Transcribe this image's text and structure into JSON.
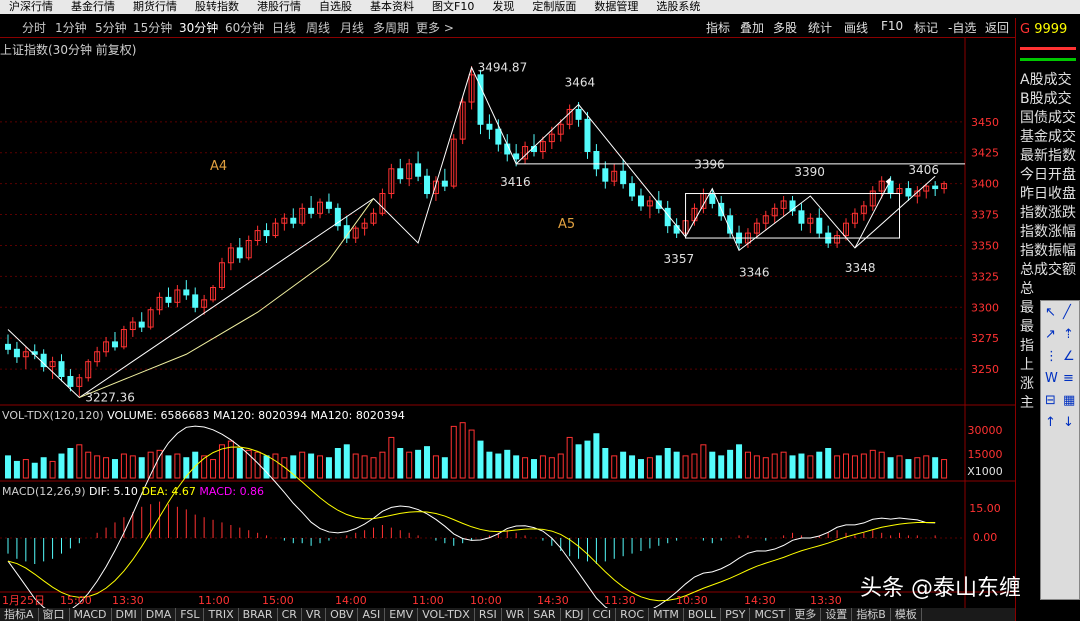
{
  "top_menu": [
    "沪深行情",
    "基金行情",
    "期货行情",
    "股转指数",
    "港股行情",
    "自选股",
    "基本资料",
    "图文F10",
    "发现",
    "定制版面",
    "数据管理",
    "选股系统"
  ],
  "period_tabs": [
    "分时",
    "1分钟",
    "5分钟",
    "15分钟",
    "30分钟",
    "60分钟",
    "日线",
    "周线",
    "月线",
    "多周期",
    "更多 >"
  ],
  "active_period": "30分钟",
  "toolbar_buttons": [
    "指标",
    "叠加",
    "多股",
    "统计",
    "画线",
    "F10",
    "标记",
    "-自选",
    "返回"
  ],
  "chart_title": "上证指数(30分钟 前复权)",
  "vol_label": {
    "name": "VOL-TDX(120,120)",
    "volume": "VOLUME: 6586683",
    "ma1": "MA120: 8020394",
    "ma2": "MA120: 8020394"
  },
  "macd_label": {
    "name": "MACD(12,26,9)",
    "dif": "DIF: 5.10",
    "dea": "DEA: 4.67",
    "macd": "MACD: 0.86"
  },
  "price_axis": [
    "3450",
    "3425",
    "3400",
    "3375",
    "3350",
    "3325",
    "3300",
    "3275",
    "3250"
  ],
  "vol_axis": [
    "30000",
    "15000",
    "X1000"
  ],
  "macd_axis": [
    "15.00",
    "0.00"
  ],
  "time_axis": [
    "1月25日",
    "15:00",
    "13:30",
    "11:00",
    "15:00",
    "14:00",
    "11:00",
    "10:00",
    "14:30",
    "11:30",
    "10:30",
    "14:30",
    "13:30"
  ],
  "annotations": {
    "high": "3494.87",
    "low": "3227.36",
    "p3464": "3464",
    "p3416": "3416",
    "p3396": "3396",
    "p3390": "3390",
    "p3406": "3406",
    "p3357": "3357",
    "p3346": "3346",
    "p3348": "3348",
    "wave_a4": "A4",
    "wave_a5": "A5"
  },
  "right_panel": {
    "header": "9999",
    "items": [
      "A股成交",
      "B股成交",
      "国债成交",
      "基金成交",
      "最新指数",
      "今日开盘",
      "昨日收盘",
      "指数涨跌",
      "指数涨幅",
      "指数振幅",
      "总成交额",
      "总",
      "最",
      "最",
      "指",
      "上",
      "涨",
      "主"
    ]
  },
  "bottom_tabs": [
    "指标A",
    "窗口",
    "MACD",
    "DMI",
    "DMA",
    "FSL",
    "TRIX",
    "BRAR",
    "CR",
    "VR",
    "OBV",
    "ASI",
    "EMV",
    "VOL-TDX",
    "RSI",
    "WR",
    "SAR",
    "KDJ",
    "CCI",
    "ROC",
    "MTM",
    "BOLL",
    "PSY",
    "MCST",
    "更多",
    "设置",
    "指标B",
    "模板"
  ],
  "watermark": "头条 @泰山东缠",
  "colors": {
    "up": "#ff3232",
    "down": "#54fcfc",
    "panel_border": "#8a0000",
    "line": "#ffffff",
    "ma_yellow": "#ffff00",
    "macd_magenta": "#ff00ff"
  },
  "chart_data": {
    "type": "candlestick",
    "ylim": [
      3225,
      3500
    ],
    "ohlc": [
      [
        3270,
        3278,
        3262,
        3266
      ],
      [
        3266,
        3272,
        3255,
        3260
      ],
      [
        3260,
        3268,
        3250,
        3264
      ],
      [
        3264,
        3270,
        3258,
        3262
      ],
      [
        3262,
        3266,
        3248,
        3252
      ],
      [
        3252,
        3260,
        3242,
        3256
      ],
      [
        3256,
        3262,
        3240,
        3244
      ],
      [
        3244,
        3250,
        3232,
        3236
      ],
      [
        3236,
        3246,
        3228,
        3243
      ],
      [
        3243,
        3258,
        3240,
        3256
      ],
      [
        3256,
        3268,
        3252,
        3264
      ],
      [
        3264,
        3276,
        3260,
        3272
      ],
      [
        3272,
        3280,
        3265,
        3268
      ],
      [
        3268,
        3285,
        3266,
        3282
      ],
      [
        3282,
        3292,
        3276,
        3288
      ],
      [
        3288,
        3296,
        3280,
        3284
      ],
      [
        3284,
        3300,
        3282,
        3298
      ],
      [
        3298,
        3312,
        3294,
        3308
      ],
      [
        3308,
        3316,
        3300,
        3304
      ],
      [
        3304,
        3318,
        3300,
        3314
      ],
      [
        3314,
        3322,
        3306,
        3310
      ],
      [
        3310,
        3316,
        3296,
        3300
      ],
      [
        3300,
        3310,
        3294,
        3306
      ],
      [
        3306,
        3318,
        3304,
        3316
      ],
      [
        3316,
        3340,
        3314,
        3336
      ],
      [
        3336,
        3352,
        3330,
        3348
      ],
      [
        3348,
        3356,
        3336,
        3340
      ],
      [
        3340,
        3358,
        3338,
        3354
      ],
      [
        3354,
        3366,
        3350,
        3362
      ],
      [
        3362,
        3368,
        3352,
        3358
      ],
      [
        3358,
        3372,
        3356,
        3368
      ],
      [
        3368,
        3376,
        3362,
        3372
      ],
      [
        3372,
        3380,
        3364,
        3368
      ],
      [
        3368,
        3384,
        3366,
        3380
      ],
      [
        3380,
        3390,
        3372,
        3376
      ],
      [
        3376,
        3388,
        3372,
        3385
      ],
      [
        3385,
        3392,
        3376,
        3380
      ],
      [
        3380,
        3384,
        3362,
        3366
      ],
      [
        3366,
        3374,
        3352,
        3356
      ],
      [
        3356,
        3366,
        3352,
        3364
      ],
      [
        3364,
        3372,
        3358,
        3368
      ],
      [
        3368,
        3380,
        3366,
        3376
      ],
      [
        3376,
        3396,
        3374,
        3392
      ],
      [
        3392,
        3416,
        3388,
        3412
      ],
      [
        3412,
        3420,
        3400,
        3404
      ],
      [
        3404,
        3420,
        3398,
        3416
      ],
      [
        3416,
        3426,
        3402,
        3406
      ],
      [
        3406,
        3412,
        3388,
        3392
      ],
      [
        3392,
        3406,
        3386,
        3402
      ],
      [
        3402,
        3412,
        3394,
        3398
      ],
      [
        3398,
        3440,
        3396,
        3436
      ],
      [
        3436,
        3470,
        3432,
        3466
      ],
      [
        3466,
        3495,
        3460,
        3488
      ],
      [
        3488,
        3492,
        3440,
        3448
      ],
      [
        3448,
        3456,
        3436,
        3444
      ],
      [
        3444,
        3452,
        3426,
        3432
      ],
      [
        3432,
        3440,
        3418,
        3424
      ],
      [
        3424,
        3432,
        3414,
        3420
      ],
      [
        3420,
        3434,
        3416,
        3430
      ],
      [
        3430,
        3440,
        3422,
        3426
      ],
      [
        3426,
        3438,
        3420,
        3434
      ],
      [
        3434,
        3446,
        3428,
        3440
      ],
      [
        3440,
        3452,
        3434,
        3448
      ],
      [
        3448,
        3464,
        3444,
        3460
      ],
      [
        3460,
        3466,
        3446,
        3452
      ],
      [
        3452,
        3458,
        3420,
        3426
      ],
      [
        3426,
        3432,
        3406,
        3412
      ],
      [
        3412,
        3418,
        3396,
        3402
      ],
      [
        3402,
        3416,
        3398,
        3410
      ],
      [
        3410,
        3420,
        3396,
        3400
      ],
      [
        3400,
        3406,
        3386,
        3390
      ],
      [
        3390,
        3396,
        3378,
        3382
      ],
      [
        3382,
        3390,
        3372,
        3386
      ],
      [
        3386,
        3394,
        3376,
        3380
      ],
      [
        3380,
        3386,
        3360,
        3366
      ],
      [
        3366,
        3372,
        3356,
        3360
      ],
      [
        3360,
        3374,
        3357,
        3370
      ],
      [
        3370,
        3384,
        3366,
        3380
      ],
      [
        3380,
        3396,
        3376,
        3392
      ],
      [
        3392,
        3396,
        3380,
        3384
      ],
      [
        3384,
        3390,
        3370,
        3374
      ],
      [
        3374,
        3380,
        3356,
        3360
      ],
      [
        3360,
        3366,
        3346,
        3352
      ],
      [
        3352,
        3364,
        3348,
        3360
      ],
      [
        3360,
        3372,
        3356,
        3368
      ],
      [
        3368,
        3378,
        3362,
        3374
      ],
      [
        3374,
        3384,
        3368,
        3380
      ],
      [
        3380,
        3390,
        3374,
        3386
      ],
      [
        3386,
        3390,
        3374,
        3378
      ],
      [
        3378,
        3384,
        3362,
        3368
      ],
      [
        3368,
        3376,
        3360,
        3372
      ],
      [
        3372,
        3380,
        3356,
        3360
      ],
      [
        3360,
        3366,
        3348,
        3352
      ],
      [
        3352,
        3362,
        3348,
        3358
      ],
      [
        3358,
        3372,
        3354,
        3368
      ],
      [
        3368,
        3380,
        3364,
        3376
      ],
      [
        3376,
        3386,
        3370,
        3382
      ],
      [
        3382,
        3398,
        3378,
        3394
      ],
      [
        3394,
        3406,
        3388,
        3402
      ],
      [
        3402,
        3406,
        3388,
        3392
      ],
      [
        3392,
        3400,
        3384,
        3396
      ],
      [
        3396,
        3402,
        3386,
        3390
      ],
      [
        3390,
        3398,
        3384,
        3394
      ],
      [
        3394,
        3400,
        3388,
        3398
      ],
      [
        3398,
        3402,
        3390,
        3396
      ],
      [
        3396,
        3402,
        3392,
        3400
      ]
    ],
    "volume": [
      12,
      9,
      10,
      8,
      11,
      9,
      13,
      16,
      18,
      14,
      12,
      11,
      10,
      13,
      12,
      11,
      14,
      15,
      12,
      13,
      11,
      14,
      12,
      10,
      18,
      20,
      16,
      15,
      14,
      12,
      13,
      11,
      12,
      14,
      13,
      12,
      11,
      16,
      18,
      13,
      12,
      11,
      14,
      22,
      16,
      14,
      15,
      17,
      12,
      11,
      28,
      30,
      26,
      20,
      14,
      13,
      15,
      12,
      11,
      10,
      12,
      11,
      13,
      22,
      18,
      20,
      24,
      16,
      12,
      14,
      12,
      10,
      11,
      12,
      16,
      14,
      12,
      13,
      18,
      14,
      12,
      15,
      18,
      14,
      12,
      11,
      13,
      14,
      12,
      13,
      12,
      14,
      16,
      12,
      13,
      12,
      13,
      15,
      14,
      11,
      12,
      10,
      11,
      12,
      11,
      10
    ],
    "macd_hist": [
      -6,
      -8,
      -9,
      -10,
      -9,
      -8,
      -6,
      -4,
      -2,
      0,
      2,
      4,
      6,
      8,
      10,
      12,
      13,
      14,
      13,
      12,
      11,
      9,
      8,
      7,
      6,
      5,
      4,
      3,
      2,
      1,
      0,
      -1,
      -2,
      -2,
      -3,
      -2,
      -1,
      0,
      1,
      2,
      3,
      4,
      5,
      4,
      3,
      2,
      1,
      0,
      -1,
      -2,
      -3,
      -2,
      -1,
      0,
      1,
      2,
      3,
      2,
      1,
      0,
      -1,
      -3,
      -5,
      -7,
      -8,
      -9,
      -10,
      -9,
      -8,
      -7,
      -6,
      -5,
      -4,
      -3,
      -2,
      -1,
      0,
      0,
      -1,
      -2,
      -1,
      0,
      1,
      1,
      0,
      -1,
      0,
      1,
      2,
      1,
      0,
      1,
      2,
      3,
      2,
      1,
      2,
      3,
      2,
      1,
      2,
      1,
      1,
      0,
      1
    ]
  }
}
